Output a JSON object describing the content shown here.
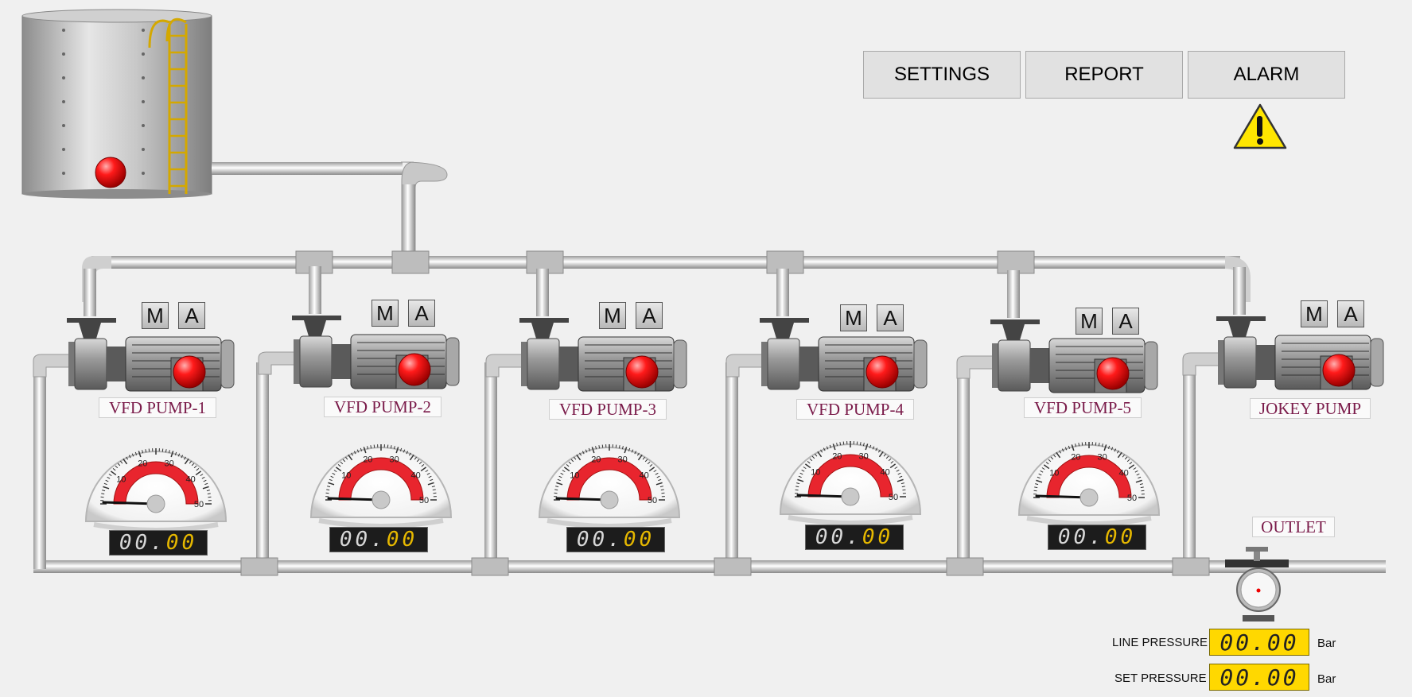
{
  "toolbar": {
    "settings_label": "SETTINGS",
    "report_label": "REPORT",
    "alarm_label": "ALARM"
  },
  "pumps": [
    {
      "name": "VFD PUMP-1",
      "manual_label": "M",
      "auto_label": "A",
      "display": "00.00"
    },
    {
      "name": "VFD PUMP-2",
      "manual_label": "M",
      "auto_label": "A",
      "display": "00.00"
    },
    {
      "name": "VFD PUMP-3",
      "manual_label": "M",
      "auto_label": "A",
      "display": "00.00"
    },
    {
      "name": "VFD PUMP-4",
      "manual_label": "M",
      "auto_label": "A",
      "display": "00.00"
    },
    {
      "name": "VFD PUMP-5",
      "manual_label": "M",
      "auto_label": "A",
      "display": "00.00"
    },
    {
      "name": "JOKEY PUMP",
      "manual_label": "M",
      "auto_label": "A"
    }
  ],
  "gauge_ticks": [
    "10",
    "20",
    "30",
    "40",
    "50"
  ],
  "outlet_label": "OUTLET",
  "line_pressure": {
    "label": "LINE PRESSURE",
    "value": "00.00",
    "unit": "Bar"
  },
  "set_pressure": {
    "label": "SET PRESSURE",
    "value": "00.00",
    "unit": "Bar"
  },
  "colors": {
    "status_off": "#e00000",
    "label_text": "#7a1b4a",
    "display_digit": "#e6b800",
    "pressure_display": "#ffd800",
    "alarm_warning": "#ffe600"
  }
}
